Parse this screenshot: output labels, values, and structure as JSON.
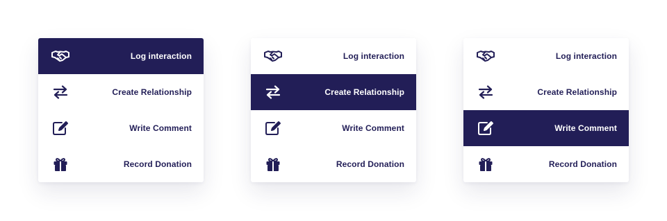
{
  "menus": [
    {
      "active_index": 0,
      "items": [
        {
          "label": "Log interaction",
          "icon": "handshake-icon"
        },
        {
          "label": "Create Relationship",
          "icon": "swap-arrows-icon"
        },
        {
          "label": "Write Comment",
          "icon": "edit-comment-icon"
        },
        {
          "label": "Record Donation",
          "icon": "gift-icon"
        }
      ]
    },
    {
      "active_index": 1,
      "items": [
        {
          "label": "Log interaction",
          "icon": "handshake-icon"
        },
        {
          "label": "Create Relationship",
          "icon": "swap-arrows-icon"
        },
        {
          "label": "Write Comment",
          "icon": "edit-comment-icon"
        },
        {
          "label": "Record Donation",
          "icon": "gift-icon"
        }
      ]
    },
    {
      "active_index": 2,
      "items": [
        {
          "label": "Log interaction",
          "icon": "handshake-icon"
        },
        {
          "label": "Create Relationship",
          "icon": "swap-arrows-icon"
        },
        {
          "label": "Write Comment",
          "icon": "edit-comment-icon"
        },
        {
          "label": "Record Donation",
          "icon": "gift-icon"
        }
      ]
    }
  ],
  "colors": {
    "primary": "#221e57",
    "active_text": "#ffffff",
    "card_background": "#ffffff"
  }
}
